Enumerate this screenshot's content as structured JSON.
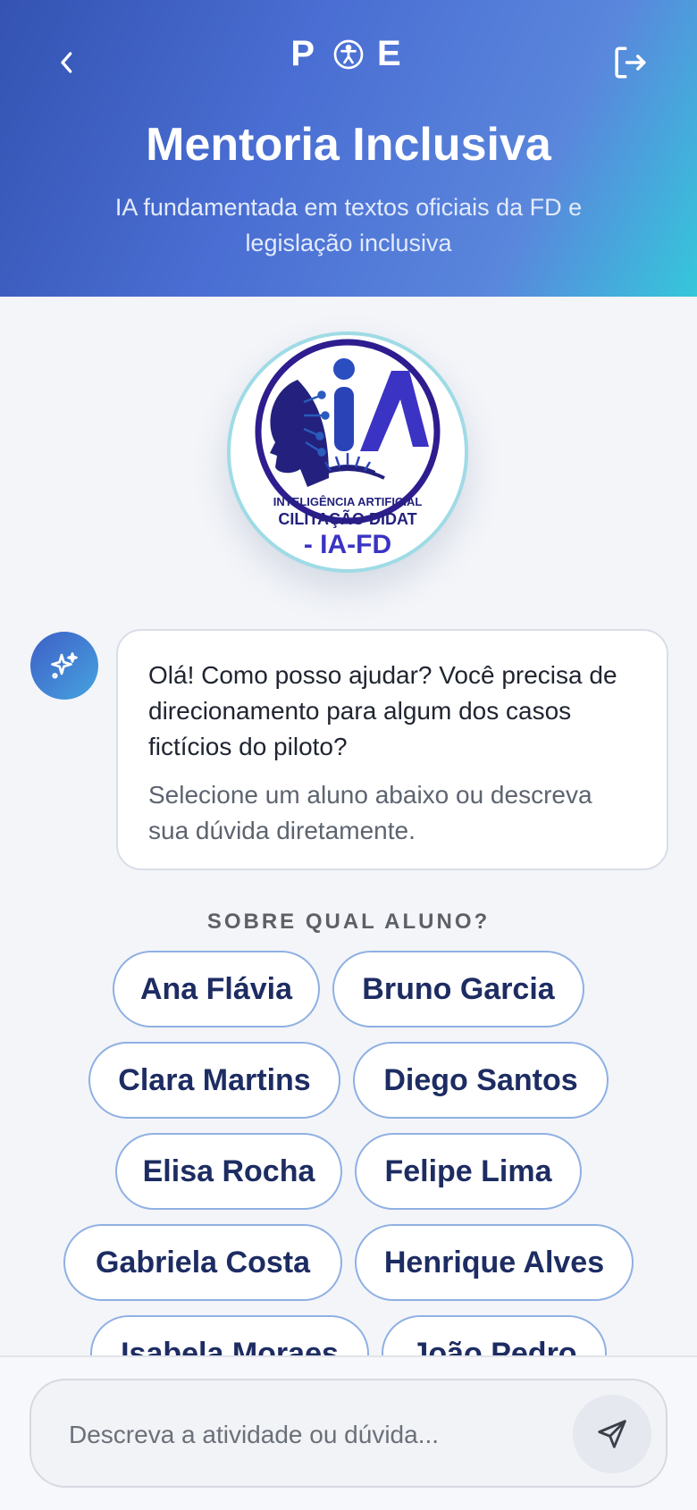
{
  "header": {
    "brand_left": "P",
    "brand_right": "E",
    "title": "Mentoria Inclusiva",
    "subtitle": "IA fundamentada em textos oficiais da FD e legislação inclusiva"
  },
  "logo": {
    "line1": "INTELIGÊNCIA ARTIFICIAL",
    "line2": "CILITAÇÃO DIDAT",
    "line3": "- IA-FD"
  },
  "chat": {
    "message": "Olá! Como posso ajudar? Você precisa de direcionamento para algum dos casos fictícios do piloto?",
    "hint": "Selecione um aluno abaixo ou descreva sua dúvida diretamente."
  },
  "students": {
    "label": "SOBRE QUAL ALUNO?",
    "names": [
      "Ana Flávia",
      "Bruno Garcia",
      "Clara Martins",
      "Diego Santos",
      "Elisa Rocha",
      "Felipe Lima",
      "Gabriela Costa",
      "Henrique Alves",
      "Isabela Moraes",
      "João Pedro"
    ]
  },
  "composer": {
    "placeholder": "Descreva a atividade ou dúvida..."
  },
  "colors": {
    "header_start": "#3453b2",
    "header_end": "#35c7db",
    "chip_border": "#8fb0e3",
    "chip_text": "#1d2c62"
  }
}
